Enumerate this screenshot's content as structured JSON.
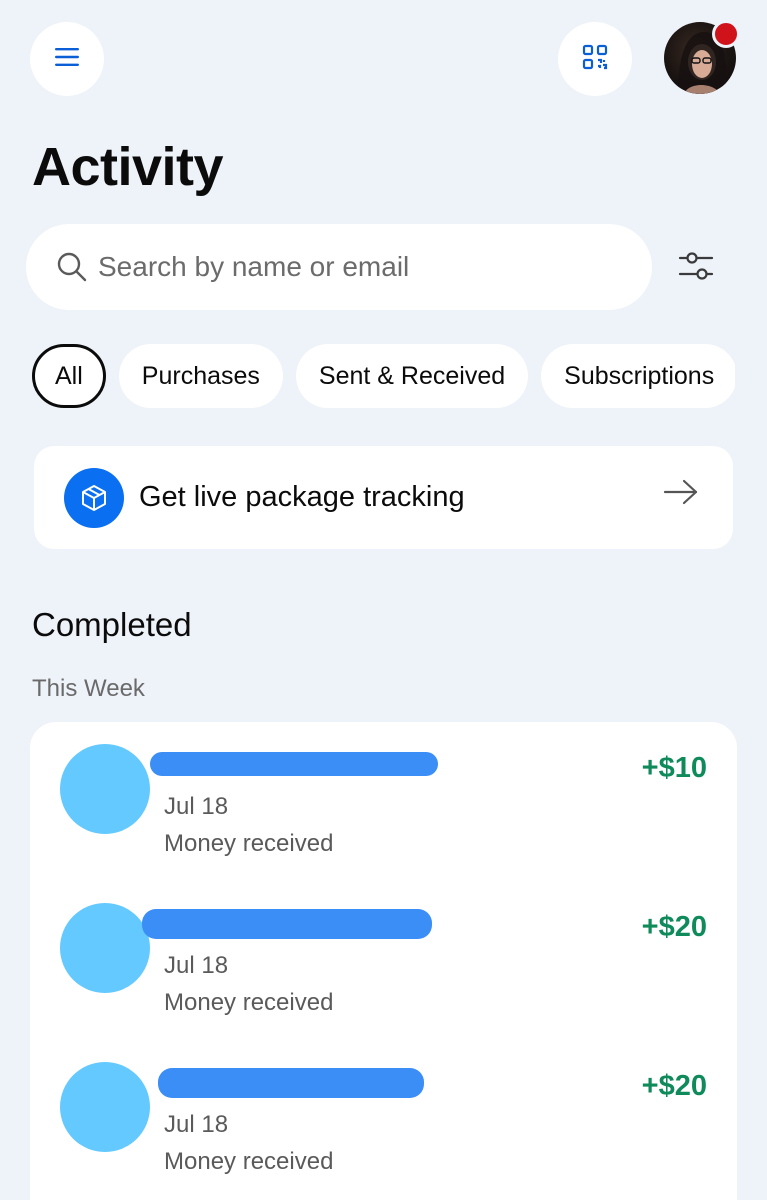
{
  "header": {
    "title": "Activity",
    "menu_icon": "hamburger-menu-icon",
    "qr_icon": "qr-code-icon",
    "notification_color": "#d0121b"
  },
  "search": {
    "placeholder": "Search by name or email",
    "value": ""
  },
  "filters": {
    "chips": [
      {
        "label": "All",
        "active": true
      },
      {
        "label": "Purchases",
        "active": false
      },
      {
        "label": "Sent & Received",
        "active": false
      },
      {
        "label": "Subscriptions",
        "active": false
      }
    ]
  },
  "tracking": {
    "label": "Get live package tracking",
    "icon": "package-icon",
    "accent": "#0a6ff0"
  },
  "completed": {
    "title": "Completed",
    "period": "This Week",
    "transactions": [
      {
        "date": "Jul 18",
        "description": "Money received",
        "amount": "+$10"
      },
      {
        "date": "Jul 18",
        "description": "Money received",
        "amount": "+$20"
      },
      {
        "date": "Jul 18",
        "description": "Money received",
        "amount": "+$20"
      }
    ]
  },
  "colors": {
    "background": "#eef2f9",
    "positive_amount": "#0f8a5a",
    "avatar_placeholder": "#63c9ff",
    "redaction": "#3a8ef6"
  }
}
